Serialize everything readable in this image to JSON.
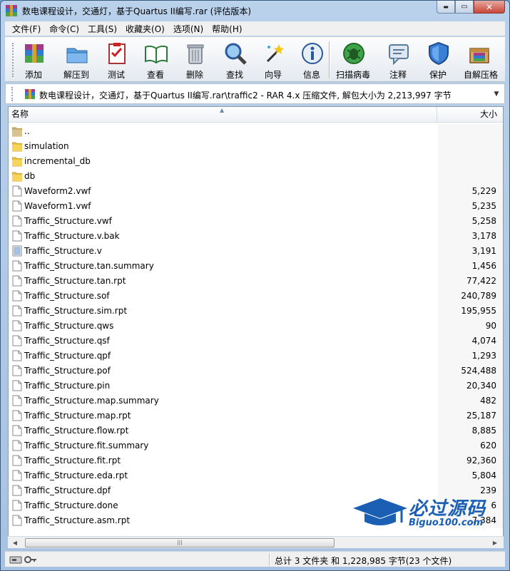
{
  "window": {
    "title": "数电课程设计，交通灯，基于Quartus II编写.rar (评估版本)",
    "controls": {
      "minimize": "▬",
      "maximize": "▭",
      "close": "✕"
    }
  },
  "menu": [
    "文件(F)",
    "命令(C)",
    "工具(S)",
    "收藏夹(O)",
    "选项(N)",
    "帮助(H)"
  ],
  "toolbar": [
    {
      "label": "添加",
      "icon": "add-archive-icon"
    },
    {
      "label": "解压到",
      "icon": "extract-to-icon"
    },
    {
      "label": "测试",
      "icon": "test-icon"
    },
    {
      "label": "查看",
      "icon": "view-icon"
    },
    {
      "label": "删除",
      "icon": "delete-icon"
    },
    {
      "label": "查找",
      "icon": "find-icon"
    },
    {
      "label": "向导",
      "icon": "wizard-icon"
    },
    {
      "label": "信息",
      "icon": "info-icon"
    },
    {
      "label": "扫描病毒",
      "icon": "virus-scan-icon"
    },
    {
      "label": "注释",
      "icon": "comment-icon"
    },
    {
      "label": "保护",
      "icon": "protect-icon"
    },
    {
      "label": "自解压格",
      "icon": "sfx-icon"
    }
  ],
  "address": {
    "text": "数电课程设计，交通灯，基于Quartus II编写.rar\\traffic2 - RAR 4.x 压缩文件, 解包大小为 2,213,997 字节"
  },
  "columns": {
    "name": "名称",
    "size": "大小"
  },
  "files": [
    {
      "name": "..",
      "size": "",
      "type": "parent"
    },
    {
      "name": "simulation",
      "size": "",
      "type": "folder"
    },
    {
      "name": "incremental_db",
      "size": "",
      "type": "folder"
    },
    {
      "name": "db",
      "size": "",
      "type": "folder"
    },
    {
      "name": "Waveform2.vwf",
      "size": "5,229",
      "type": "file"
    },
    {
      "name": "Waveform1.vwf",
      "size": "5,235",
      "type": "file"
    },
    {
      "name": "Traffic_Structure.vwf",
      "size": "5,258",
      "type": "file"
    },
    {
      "name": "Traffic_Structure.v.bak",
      "size": "3,178",
      "type": "file"
    },
    {
      "name": "Traffic_Structure.v",
      "size": "3,191",
      "type": "vfile"
    },
    {
      "name": "Traffic_Structure.tan.summary",
      "size": "1,456",
      "type": "file"
    },
    {
      "name": "Traffic_Structure.tan.rpt",
      "size": "77,422",
      "type": "file"
    },
    {
      "name": "Traffic_Structure.sof",
      "size": "240,789",
      "type": "file"
    },
    {
      "name": "Traffic_Structure.sim.rpt",
      "size": "195,955",
      "type": "file"
    },
    {
      "name": "Traffic_Structure.qws",
      "size": "90",
      "type": "file"
    },
    {
      "name": "Traffic_Structure.qsf",
      "size": "4,074",
      "type": "file"
    },
    {
      "name": "Traffic_Structure.qpf",
      "size": "1,293",
      "type": "file"
    },
    {
      "name": "Traffic_Structure.pof",
      "size": "524,488",
      "type": "file"
    },
    {
      "name": "Traffic_Structure.pin",
      "size": "20,340",
      "type": "file"
    },
    {
      "name": "Traffic_Structure.map.summary",
      "size": "482",
      "type": "file"
    },
    {
      "name": "Traffic_Structure.map.rpt",
      "size": "25,187",
      "type": "file"
    },
    {
      "name": "Traffic_Structure.flow.rpt",
      "size": "8,885",
      "type": "file"
    },
    {
      "name": "Traffic_Structure.fit.summary",
      "size": "620",
      "type": "file"
    },
    {
      "name": "Traffic_Structure.fit.rpt",
      "size": "92,360",
      "type": "file"
    },
    {
      "name": "Traffic_Structure.eda.rpt",
      "size": "5,804",
      "type": "file"
    },
    {
      "name": "Traffic_Structure.dpf",
      "size": "239",
      "type": "file"
    },
    {
      "name": "Traffic_Structure.done",
      "size": "6",
      "type": "file"
    },
    {
      "name": "Traffic_Structure.asm.rpt",
      "size": "7,384",
      "type": "file"
    }
  ],
  "status": {
    "text": "总计 3 文件夹 和 1,228,985 字节(23 个文件)"
  },
  "watermark": {
    "cn": "必过源码",
    "en": "Biguo100.com"
  },
  "colors": {
    "folder": "#f2c23a",
    "watermark": "#1a5fb4"
  }
}
